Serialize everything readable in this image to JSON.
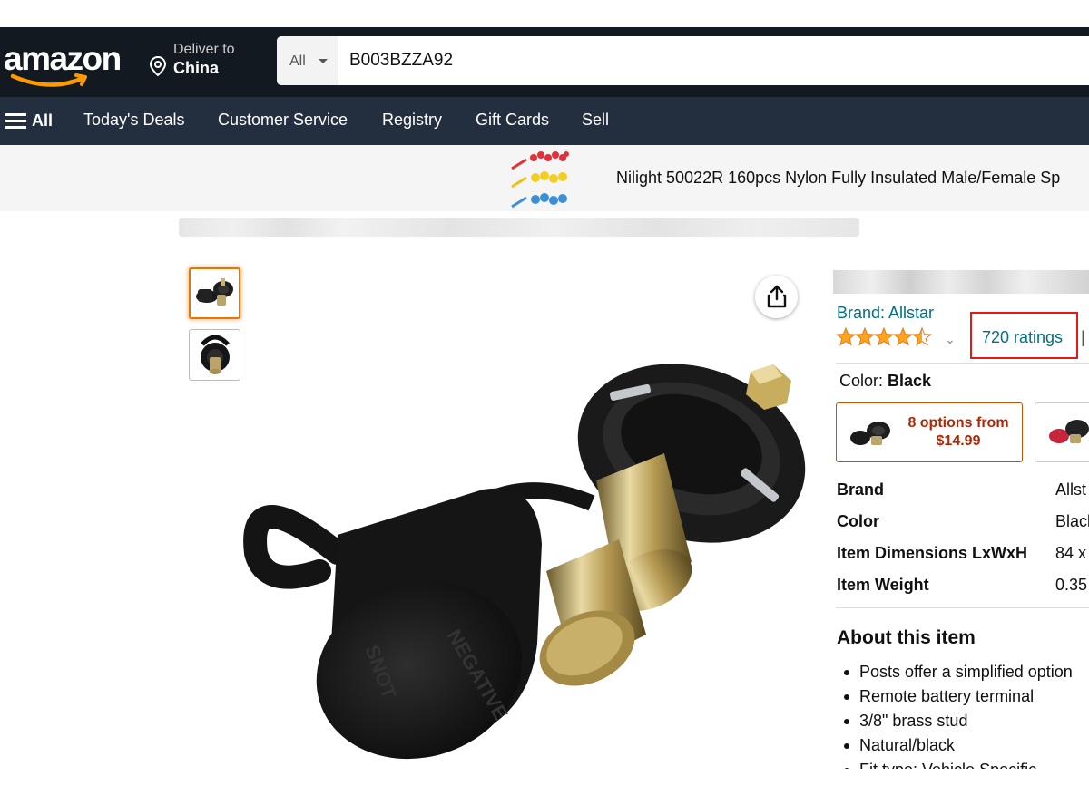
{
  "header": {
    "logo_text": "amazon",
    "deliver_line1": "Deliver to",
    "deliver_line2": "China",
    "search_category": "All",
    "search_value": "B003BZZA92"
  },
  "nav": {
    "all_label": "All",
    "items": [
      "Today's Deals",
      "Customer Service",
      "Registry",
      "Gift Cards",
      "Sell"
    ]
  },
  "promo": {
    "text": "Nilight 50022R 160pcs Nylon Fully Insulated Male/Female Sp"
  },
  "product": {
    "brand": "Brand: Allstar",
    "rating_out_of_5": 4.5,
    "ratings_count": "720 ratings",
    "separator": "|",
    "color_label": "Color: ",
    "color_value": "Black",
    "swatch_text_1": "8 options from",
    "swatch_text_2": "$14.99",
    "specs": [
      {
        "key": "Brand",
        "value": "Allst"
      },
      {
        "key": "Color",
        "value": "Blacl"
      },
      {
        "key": "Item Dimensions LxWxH",
        "value": "84 x"
      },
      {
        "key": "Item Weight",
        "value": "0.35"
      }
    ],
    "about_title": "About this item",
    "bullets": [
      "Posts offer a simplified option",
      "Remote battery terminal",
      "3/8\" brass stud",
      "Natural/black",
      "Fit type: Vehicle Specific"
    ]
  },
  "colors": {
    "header_bg": "#131921",
    "nav_bg": "#232f3e",
    "link": "#007185",
    "price": "#b12704",
    "star": "#ffa41c",
    "highlight_box": "#e21a1a"
  }
}
